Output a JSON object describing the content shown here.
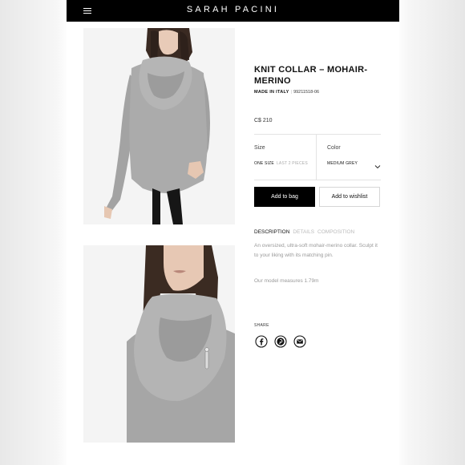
{
  "header": {
    "brand": "SARAH PACINI",
    "menu_icon": "hamburger-menu-icon"
  },
  "product": {
    "title": "KNIT COLLAR – MOHAIR-MERINO",
    "made_in": "MADE IN ITALY",
    "sku": "99211518-06",
    "price": "C$ 210"
  },
  "options": {
    "size_label": "Size",
    "size_value": "ONE SIZE",
    "stock_note": "LAST 2 PIECES",
    "color_label": "Color",
    "color_value": "MEDIUM GREY",
    "color_icon": "chevron-down-icon"
  },
  "actions": {
    "add_to_bag": "Add to bag",
    "add_to_wishlist": "Add to wishlist"
  },
  "tabs": [
    "DESCRIPTION",
    "DETAILS",
    "COMPOSITION"
  ],
  "description": {
    "text": "An oversized, ultra-soft mohair-merino collar. Sculpt it to your liking with its matching pin.",
    "model": "Our model measures 1.79m"
  },
  "share": {
    "label": "SHARE",
    "icons": [
      "facebook-icon",
      "pinterest-icon",
      "email-icon"
    ]
  },
  "colors": {
    "topbar": "#000000",
    "sweater": "#a9a9a9",
    "button_primary": "#000000"
  }
}
